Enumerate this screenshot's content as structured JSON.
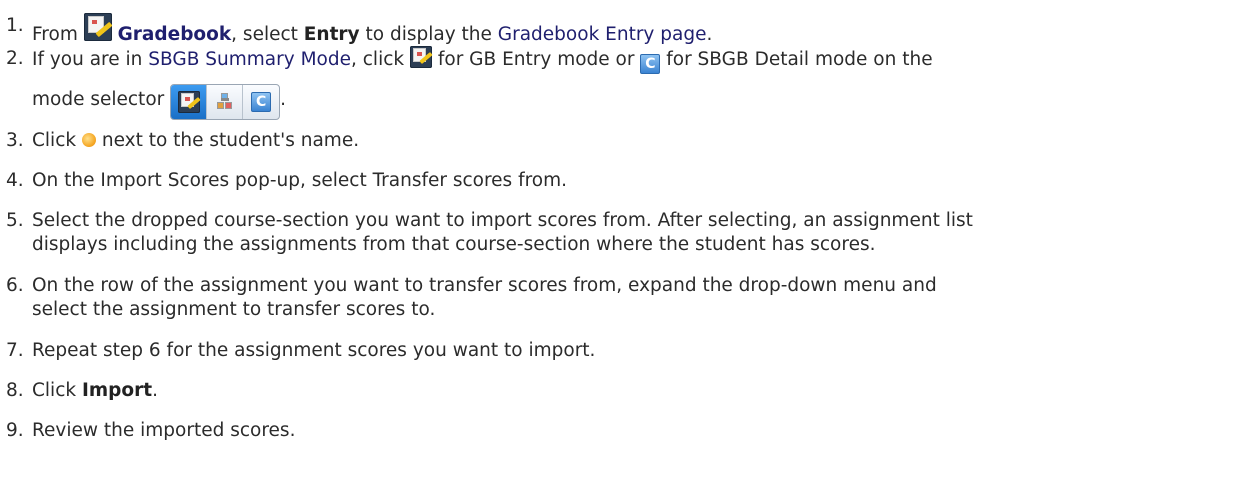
{
  "steps": [
    {
      "num": "1.",
      "pre": "From ",
      "link": "Gradebook",
      "mid": ", select ",
      "bold2": "Entry",
      "mid2": " to display the ",
      "link2": "Gradebook Entry page",
      "post": "."
    },
    {
      "num": "2.",
      "pre": "If you are in ",
      "link": "SBGB Summary Mode",
      "mid": ", click ",
      "mid2": " for GB Entry mode or ",
      "mid3": " for SBGB Detail mode on the",
      "cont": "mode selector ",
      "post": "."
    },
    {
      "num": "3.",
      "pre": "Click ",
      "post": " next to the student's name."
    },
    {
      "num": "4.",
      "text": "On the Import Scores pop-up, select Transfer scores from."
    },
    {
      "num": "5.",
      "text": "Select the dropped course-section you want to import scores from. After selecting, an assignment list",
      "cont": "displays including the assignments from that course-section where the student has scores."
    },
    {
      "num": "6.",
      "text": "On the row of the assignment you want to transfer scores from, expand the drop-down menu and",
      "cont": "select the assignment to transfer scores to."
    },
    {
      "num": "7.",
      "text": "Repeat step 6 for the assignment scores you want to import."
    },
    {
      "num": "8.",
      "pre": "Click ",
      "bold": "Import",
      "post": "."
    },
    {
      "num": "9.",
      "text": "Review the imported scores."
    }
  ],
  "icons": {
    "gradebook": "gradebook-entry-icon",
    "detail": "sbgb-detail-icon",
    "import": "import-scores-icon",
    "selector": [
      "gradebook-entry-icon",
      "sbgb-summary-icon",
      "sbgb-detail-icon"
    ],
    "detail_letter": "C"
  },
  "colors": {
    "link": "#1f1f6e",
    "selector_active": "#1a6fc6",
    "import_dot": "#f5a623"
  }
}
